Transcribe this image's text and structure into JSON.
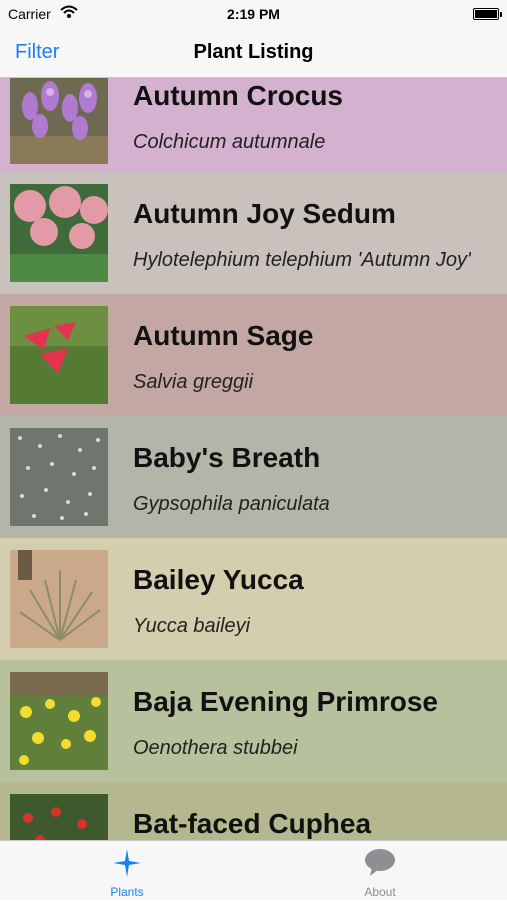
{
  "status": {
    "carrier": "Carrier",
    "time": "2:19 PM"
  },
  "nav": {
    "filter_label": "Filter",
    "title": "Plant Listing"
  },
  "plants": [
    {
      "name": "Autumn Crocus",
      "scientific": "Colchicum autumnale",
      "bg": "#d4b2cf"
    },
    {
      "name": "Autumn Joy Sedum",
      "scientific": "Hylotelephium telephium 'Autumn Joy'",
      "bg": "#c9c2bc"
    },
    {
      "name": "Autumn Sage",
      "scientific": "Salvia greggii",
      "bg": "#c3a7a2"
    },
    {
      "name": "Baby's Breath",
      "scientific": "Gypsophila paniculata",
      "bg": "#b3b5a9"
    },
    {
      "name": "Bailey Yucca",
      "scientific": "Yucca baileyi",
      "bg": "#d5ceae"
    },
    {
      "name": "Baja Evening Primrose",
      "scientific": "Oenothera stubbei",
      "bg": "#b7c19e"
    },
    {
      "name": "Bat-faced Cuphea",
      "scientific": "",
      "bg": "#b5b78e"
    }
  ],
  "tabs": [
    {
      "label": "Plants",
      "color": "#1a7ff5"
    },
    {
      "label": "About",
      "color": "#8e8e93"
    }
  ]
}
